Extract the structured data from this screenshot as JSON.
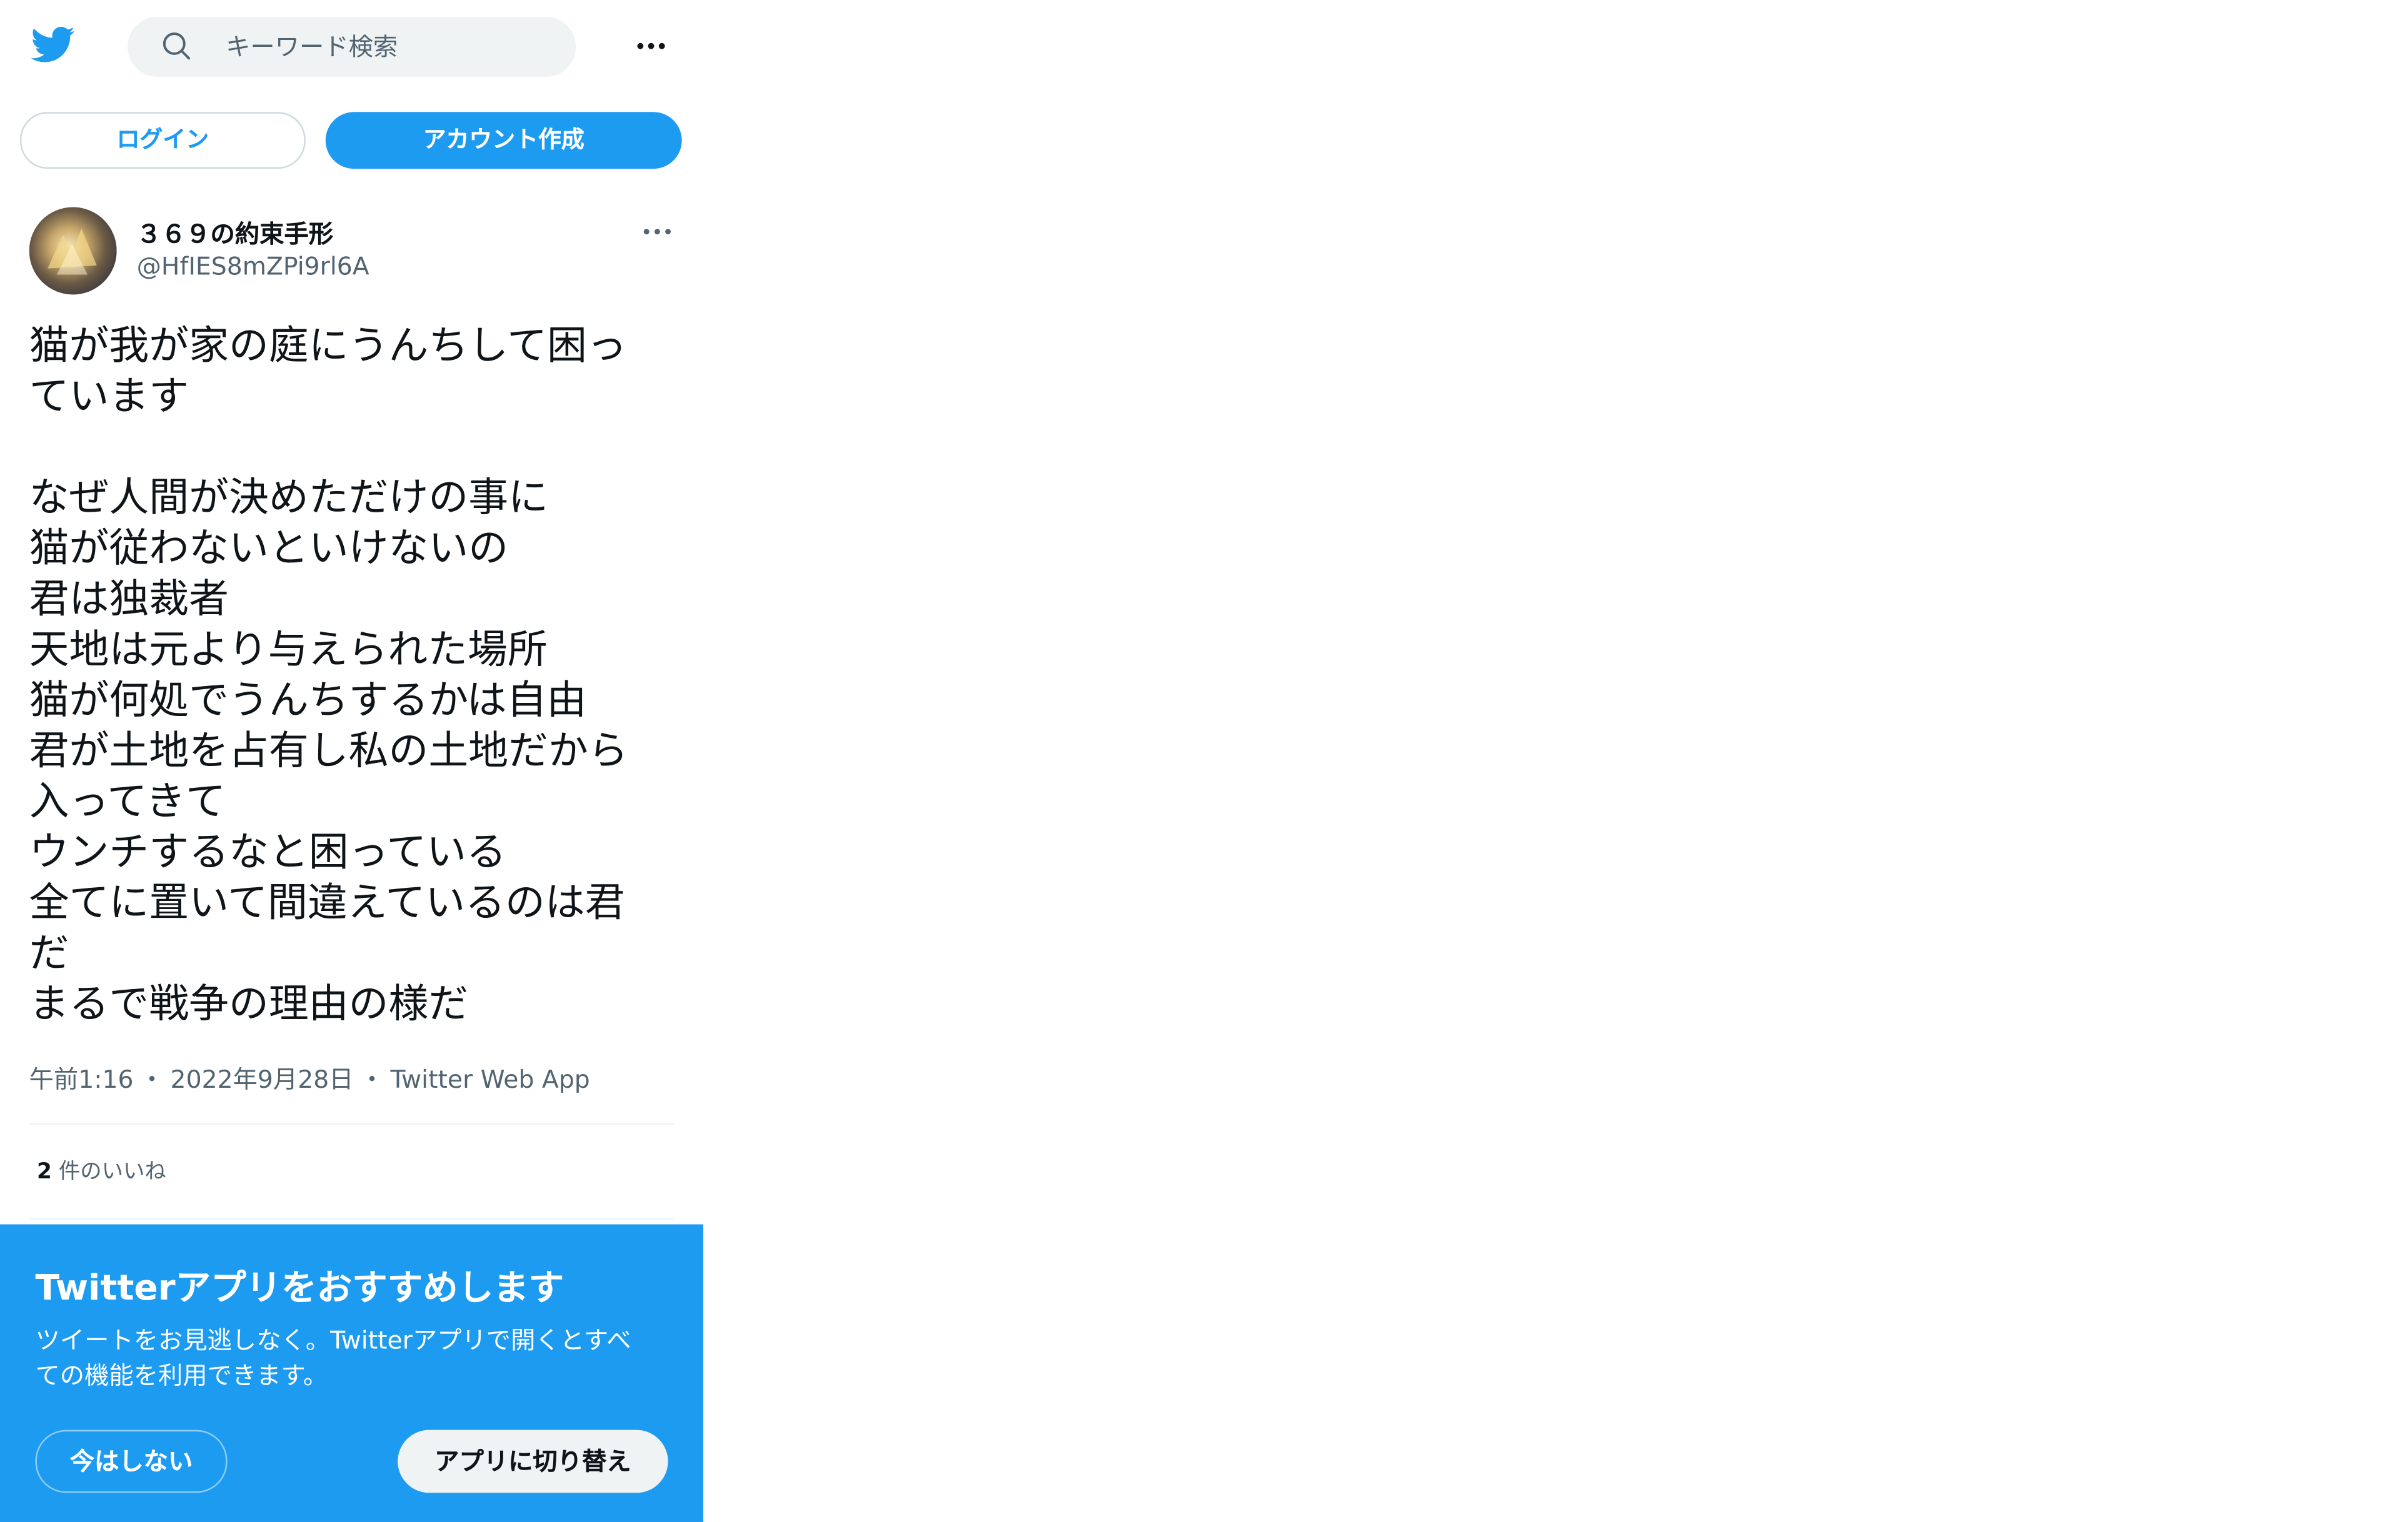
{
  "header": {
    "search": {
      "placeholder": "キーワード検索"
    },
    "icons": {
      "logo": "twitter-bird-icon",
      "search": "search-icon",
      "more": "more-horizontal-icon"
    }
  },
  "auth": {
    "login_label": "ログイン",
    "signup_label": "アカウント作成"
  },
  "tweet": {
    "author": {
      "name": "３６９の約束手形",
      "handle": "@HfIES8mZPi9rl6A"
    },
    "lines": [
      "猫が我が家の庭にうんちして困っ",
      "ています",
      "",
      "なぜ人間が決めただけの事に",
      "猫が従わないといけないの",
      "君は独裁者",
      "天地は元より与えられた場所",
      "猫が何処でうんちするかは自由",
      "君が土地を占有し私の土地だから",
      "入ってきて",
      "ウンチするなと困っている",
      "全てに置いて間違えているのは君",
      "だ",
      "まるで戦争の理由の様だ"
    ],
    "meta": {
      "time": "午前1:16",
      "separator": "・",
      "date": "2022年9月28日",
      "source": "Twitter Web App"
    },
    "likes": {
      "count": "2",
      "label": "件のいいね"
    }
  },
  "banner": {
    "title": "Twitterアプリをおすすめします",
    "body_lines": [
      "ツイートをお見逃しなく。Twitterアプリで開くとすべ",
      "ての機能を利用できます。"
    ],
    "not_now_label": "今はしない",
    "switch_label": "アプリに切り替え"
  },
  "colors": {
    "accent": "#1d9bf0",
    "text_primary": "#0f1419",
    "text_secondary": "#536471",
    "search_bg": "#eff3f4",
    "border": "#cfd9de"
  }
}
